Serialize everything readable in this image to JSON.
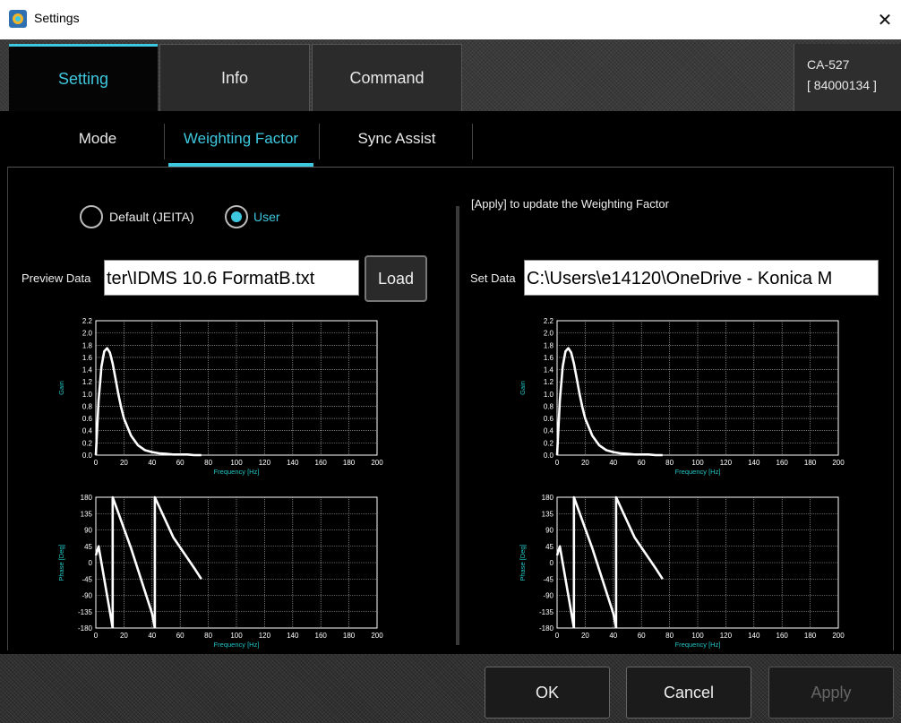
{
  "window": {
    "title": "Settings"
  },
  "main_tabs": [
    {
      "label": "Setting",
      "active": true
    },
    {
      "label": "Info",
      "active": false
    },
    {
      "label": "Command",
      "active": false
    }
  ],
  "device": {
    "model": "CA-527",
    "serial": "[ 84000134 ]"
  },
  "sub_tabs": [
    {
      "label": "Mode",
      "active": false
    },
    {
      "label": "Weighting Factor",
      "active": true
    },
    {
      "label": "Sync Assist",
      "active": false
    }
  ],
  "left": {
    "radio_default": "Default (JEITA)",
    "radio_user": "User",
    "selected": "User",
    "preview_label": "Preview Data",
    "preview_value": "ter\\IDMS 10.6 FormatB.txt",
    "load_label": "Load"
  },
  "right": {
    "hint": "[Apply] to update the Weighting Factor",
    "set_label": "Set Data",
    "set_value": "C:\\Users\\e14120\\OneDrive - Konica M"
  },
  "buttons": {
    "ok": "OK",
    "cancel": "Cancel",
    "apply": "Apply",
    "apply_enabled": false
  },
  "colors": {
    "accent": "#3ec8e0",
    "axis_label": "#21c7c7"
  },
  "chart_data": [
    {
      "id": "left-gain",
      "type": "line",
      "xlabel": "Frequency [Hz]",
      "ylabel": "Gain",
      "xlim": [
        0,
        200
      ],
      "ylim": [
        0,
        2.2
      ],
      "xticks": [
        0,
        20,
        40,
        60,
        80,
        100,
        120,
        140,
        160,
        180,
        200
      ],
      "yticks": [
        0.0,
        0.2,
        0.4,
        0.6,
        0.8,
        1.0,
        1.2,
        1.4,
        1.6,
        1.8,
        2.0,
        2.2
      ],
      "ytick_labels": [
        "0.0",
        "0.2",
        "0.4",
        "0.6",
        "0.8",
        "1.0",
        "1.2",
        "1.4",
        "1.6",
        "1.8",
        "2.0",
        "2.2"
      ],
      "grid": true,
      "series": [
        {
          "x": [
            0,
            2,
            4,
            6,
            8,
            10,
            12,
            14,
            16,
            18,
            20,
            25,
            30,
            35,
            40,
            45,
            50,
            55,
            60,
            65,
            70,
            75
          ],
          "y": [
            0,
            0.9,
            1.45,
            1.7,
            1.75,
            1.68,
            1.5,
            1.25,
            1.0,
            0.78,
            0.6,
            0.32,
            0.16,
            0.08,
            0.05,
            0.03,
            0.02,
            0.01,
            0.01,
            0.01,
            0.0,
            0.0
          ]
        }
      ]
    },
    {
      "id": "left-phase",
      "type": "line",
      "xlabel": "Frequency [Hz]",
      "ylabel": "Phase [Deg]",
      "xlim": [
        0,
        200
      ],
      "ylim": [
        -180,
        180
      ],
      "xticks": [
        0,
        20,
        40,
        60,
        80,
        100,
        120,
        140,
        160,
        180,
        200
      ],
      "yticks": [
        -180,
        -135,
        -90,
        -45,
        0,
        45,
        90,
        135,
        180
      ],
      "grid": true,
      "series": [
        {
          "segments": [
            {
              "x": [
                0,
                2,
                6,
                10,
                12
              ],
              "y": [
                20,
                45,
                -45,
                -135,
                -180
              ]
            },
            {
              "x": [
                12,
                12,
                25,
                40,
                42
              ],
              "y": [
                -180,
                180,
                40,
                -140,
                -180
              ]
            },
            {
              "x": [
                42,
                42,
                55,
                70,
                75
              ],
              "y": [
                -180,
                180,
                70,
                -15,
                -45
              ]
            }
          ]
        }
      ]
    },
    {
      "id": "right-gain",
      "type": "line",
      "xlabel": "Frequency [Hz]",
      "ylabel": "Gain",
      "xlim": [
        0,
        200
      ],
      "ylim": [
        0,
        2.2
      ],
      "xticks": [
        0,
        20,
        40,
        60,
        80,
        100,
        120,
        140,
        160,
        180,
        200
      ],
      "yticks": [
        0.0,
        0.2,
        0.4,
        0.6,
        0.8,
        1.0,
        1.2,
        1.4,
        1.6,
        1.8,
        2.0,
        2.2
      ],
      "ytick_labels": [
        "0.0",
        "0.2",
        "0.4",
        "0.6",
        "0.8",
        "1.0",
        "1.2",
        "1.4",
        "1.6",
        "1.8",
        "2.0",
        "2.2"
      ],
      "grid": true,
      "series": [
        {
          "x": [
            0,
            2,
            4,
            6,
            8,
            10,
            12,
            14,
            16,
            18,
            20,
            25,
            30,
            35,
            40,
            45,
            50,
            55,
            60,
            65,
            70,
            75
          ],
          "y": [
            0,
            0.9,
            1.45,
            1.7,
            1.75,
            1.68,
            1.5,
            1.25,
            1.0,
            0.78,
            0.6,
            0.32,
            0.16,
            0.08,
            0.05,
            0.03,
            0.02,
            0.01,
            0.01,
            0.01,
            0.0,
            0.0
          ]
        }
      ]
    },
    {
      "id": "right-phase",
      "type": "line",
      "xlabel": "Frequency [Hz]",
      "ylabel": "Phase [Deg]",
      "xlim": [
        0,
        200
      ],
      "ylim": [
        -180,
        180
      ],
      "xticks": [
        0,
        20,
        40,
        60,
        80,
        100,
        120,
        140,
        160,
        180,
        200
      ],
      "yticks": [
        -180,
        -135,
        -90,
        -45,
        0,
        45,
        90,
        135,
        180
      ],
      "grid": true,
      "series": [
        {
          "segments": [
            {
              "x": [
                0,
                2,
                6,
                10,
                12
              ],
              "y": [
                20,
                45,
                -45,
                -135,
                -180
              ]
            },
            {
              "x": [
                12,
                12,
                25,
                40,
                42
              ],
              "y": [
                -180,
                180,
                40,
                -140,
                -180
              ]
            },
            {
              "x": [
                42,
                42,
                55,
                70,
                75
              ],
              "y": [
                -180,
                180,
                70,
                -15,
                -45
              ]
            }
          ]
        }
      ]
    }
  ]
}
